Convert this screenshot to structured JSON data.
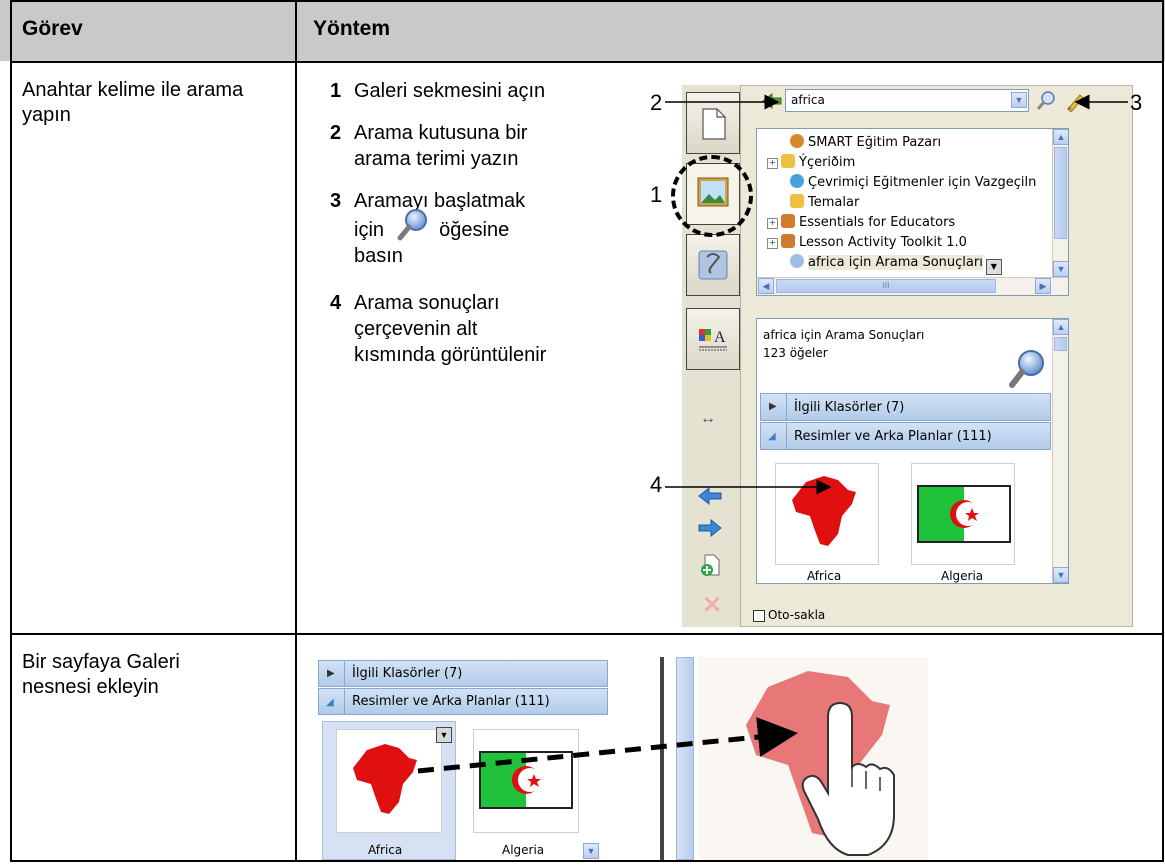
{
  "header": {
    "col1": "Görev",
    "col2": "Yöntem"
  },
  "row1": {
    "task": "Anahtar kelime ile arama yapın",
    "steps": [
      {
        "num": "1",
        "lines": [
          "Galeri sekmesini açın"
        ]
      },
      {
        "num": "2",
        "lines": [
          "Arama kutusuna bir",
          "arama terimi yazın"
        ]
      },
      {
        "num": "3",
        "lines": [
          "Aramayı başlatmak",
          "için",
          "öğesine",
          "basın"
        ]
      },
      {
        "num": "4",
        "lines": [
          "Arama sonuçları",
          "çerçevenin alt",
          "kısmında görüntülenir"
        ]
      }
    ],
    "callouts": {
      "c1": "1",
      "c2": "2",
      "c3": "3",
      "c4": "4"
    },
    "gallery": {
      "search_value": "africa",
      "tree": [
        {
          "label": "SMART Eğitim Pazarı"
        },
        {
          "label": "Ýçeriðim"
        },
        {
          "label": "Çevrimiçi Eğitmenler için Vazgeçiln"
        },
        {
          "label": "Temalar"
        },
        {
          "label": "Essentials for Educators"
        },
        {
          "label": "Lesson Activity Toolkit 1.0"
        },
        {
          "label": "africa için Arama Sonuçları"
        }
      ],
      "results_title": "africa için Arama Sonuçları",
      "results_count": "123 öğeler",
      "folders_bar": "İlgili Klasörler (7)",
      "images_bar": "Resimler ve Arka Planlar (111)",
      "thumbs": [
        "Africa",
        "Algeria"
      ],
      "autohide": "Oto-sakla",
      "scroll_mark": "III"
    }
  },
  "row2": {
    "task": "Bir sayfaya Galeri nesnesi ekleyin",
    "folders_bar": "İlgili Klasörler (7)",
    "images_bar": "Resimler ve Arka Planlar (111)",
    "thumbs": [
      "Africa",
      "Algeria"
    ]
  },
  "colors": {
    "header_bg": "#c9c9c9",
    "africa_red": "#e01010",
    "africa_pink": "#e87878",
    "bar_blue": "#b9d0ec"
  }
}
